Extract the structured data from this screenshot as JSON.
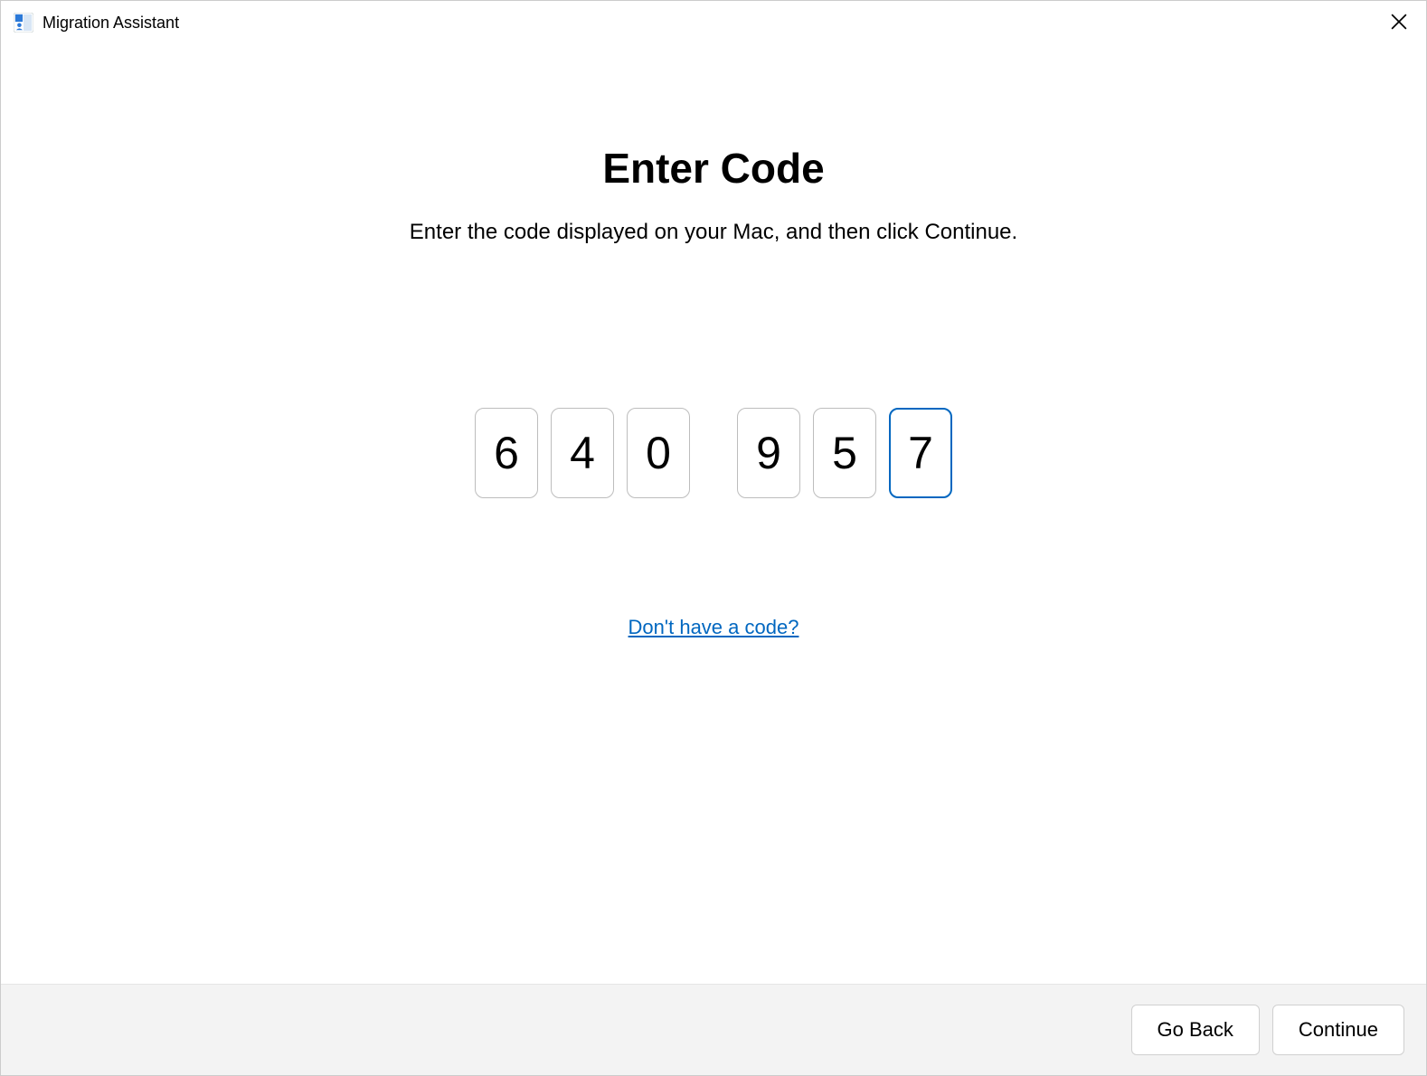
{
  "titlebar": {
    "app_title": "Migration Assistant"
  },
  "main": {
    "heading": "Enter Code",
    "subtext": "Enter the code displayed on your Mac, and then click Continue.",
    "code_digits": [
      "6",
      "4",
      "0",
      "9",
      "5",
      "7"
    ],
    "active_index": 5,
    "help_link": "Don't have a code?"
  },
  "footer": {
    "go_back_label": "Go Back",
    "continue_label": "Continue"
  }
}
